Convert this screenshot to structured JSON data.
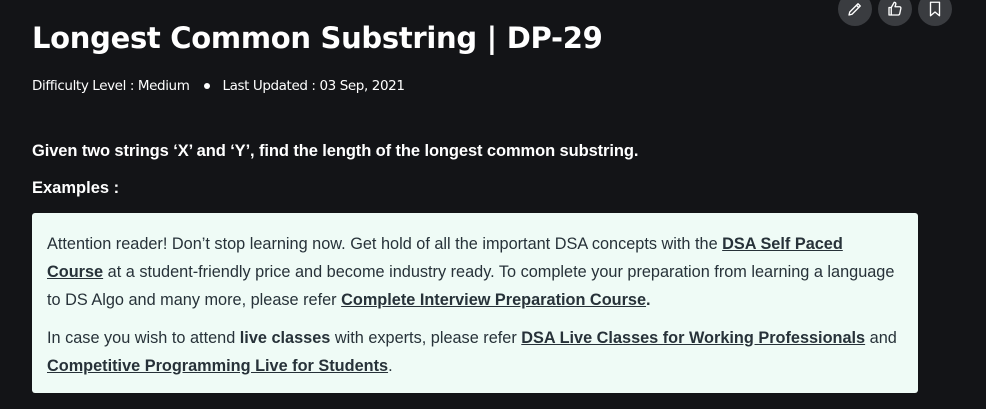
{
  "actions": {
    "edit_icon": "pencil-icon",
    "like_icon": "thumbs-up-icon",
    "bookmark_icon": "bookmark-icon"
  },
  "article": {
    "title": "Longest Common Substring | DP-29",
    "difficulty": "Difficulty Level : Medium",
    "last_updated": "Last Updated : 03 Sep, 2021",
    "intro": "Given two strings ‘X’ and ‘Y’, find the length of the longest common substring.",
    "examples_heading": "Examples :"
  },
  "notice": {
    "p1_a": "Attention reader! Don’t stop learning now. Get hold of all the important DSA concepts with the ",
    "p1_link1": "DSA Self Paced Course",
    "p1_b": " at a student-friendly price and become industry ready.  To complete your preparation from learning a language to DS Algo and many more,  please refer ",
    "p1_link2": "Complete Interview Preparation Course",
    "p1_c": ".",
    "p2_a": "In case you wish to attend ",
    "p2_bold": "live classes",
    "p2_b": " with experts, please refer ",
    "p2_link1": "DSA Live Classes for Working Professionals",
    "p2_c": " and ",
    "p2_link2": "Competitive Programming Live for Students",
    "p2_d": "."
  },
  "colors": {
    "background": "#131417",
    "notice_bg": "#effbf6",
    "notice_text": "#273239",
    "button_bg": "#3a3c40"
  }
}
